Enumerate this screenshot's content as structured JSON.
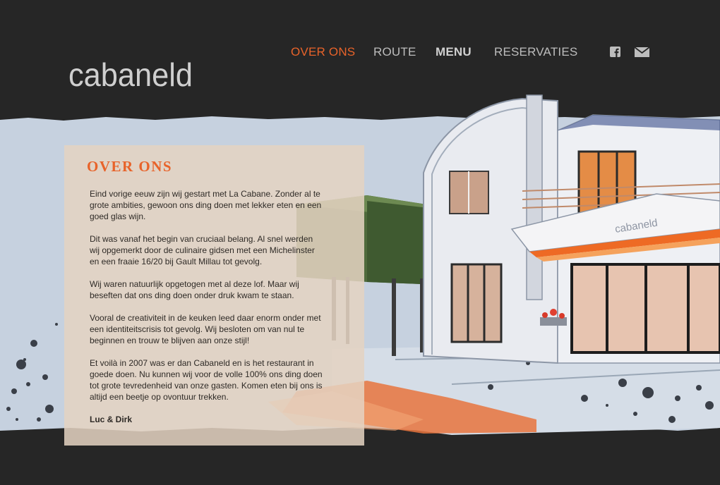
{
  "brand": {
    "logo_text": "cabaneld"
  },
  "nav": {
    "items": [
      {
        "label": "OVER ONS"
      },
      {
        "label": "ROUTE"
      },
      {
        "label": "MENU"
      },
      {
        "label": "RESERVATIES"
      }
    ],
    "social": [
      "facebook-icon",
      "mail-icon"
    ]
  },
  "illustration": {
    "sign_text": "cabaneld"
  },
  "about": {
    "heading": "OVER ONS",
    "paragraphs": [
      "Eind vorige eeuw zijn wij gestart met La Cabane. Zonder al te grote ambities, gewoon ons ding doen met lekker eten en een goed glas wijn.",
      "Dit was vanaf het begin van cruciaal belang. Al snel werden wij opgemerkt door de culinaire gidsen met een Michelinster en een fraaie 16/20 bij Gault Millau tot gevolg.",
      "Wij waren natuurlijk opgetogen met al deze lof. Maar wij beseften dat ons ding doen onder druk kwam te staan.",
      "Vooral de creativiteit in de keuken leed daar enorm onder met een identiteitscrisis tot gevolg. Wij besloten om van nul te beginnen en trouw te blijven aan onze stijl!",
      "Et voilà in 2007 was er dan Cabaneld en is het restaurant in goede doen. Nu kunnen wij voor de volle 100% ons ding doen tot grote tevredenheid van onze gasten. Komen eten bij ons is altijd een beetje op ovontuur trekken."
    ],
    "signature": "Luc & Dirk"
  },
  "colors": {
    "accent": "#e8632a",
    "background": "#262626",
    "panel": "#e4d3c1"
  }
}
